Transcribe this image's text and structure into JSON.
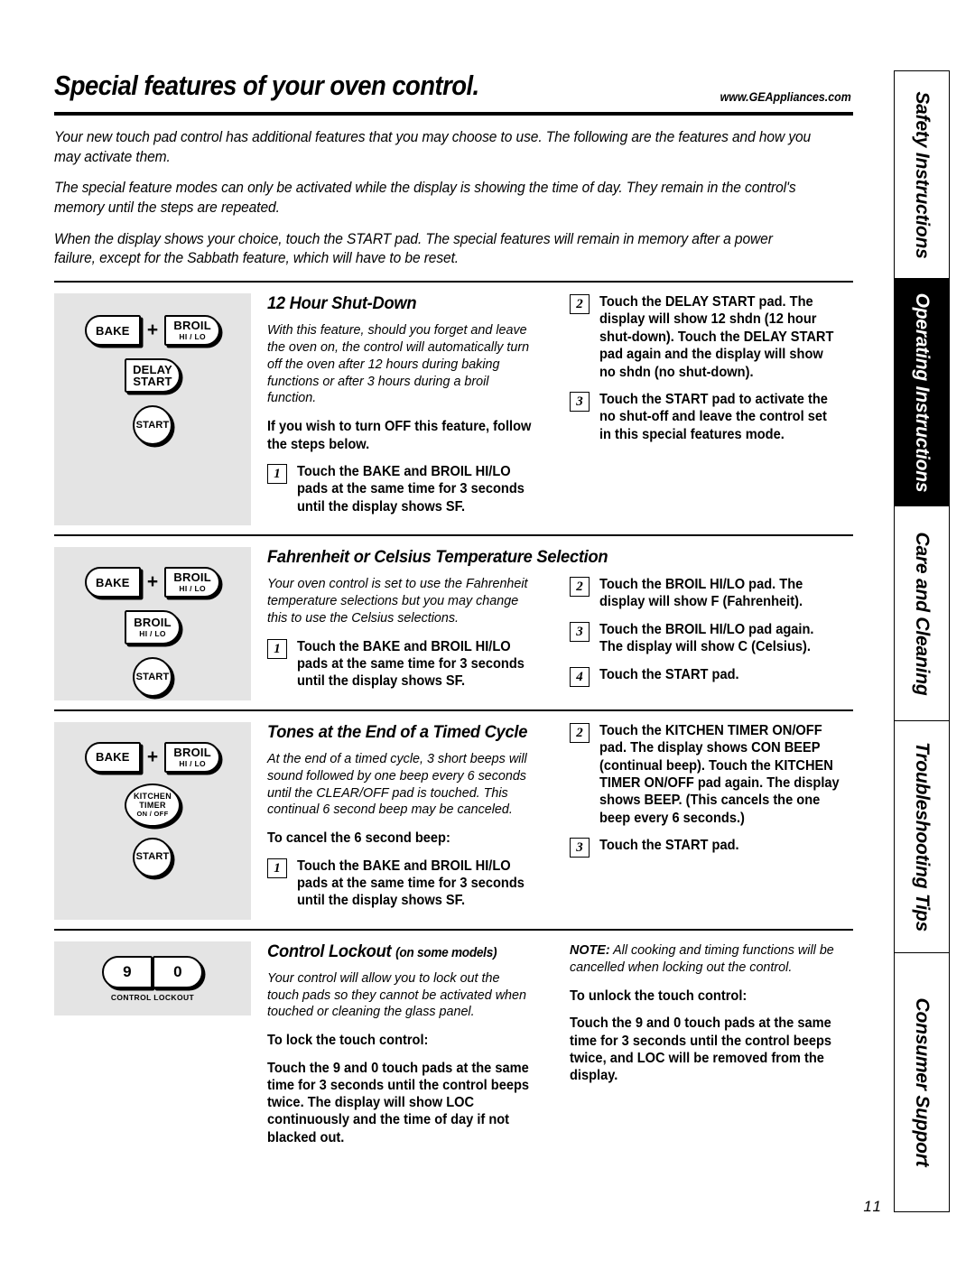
{
  "header": {
    "title": "Special features of your oven control.",
    "url": "www.GEAppliances.com"
  },
  "intro": [
    "Your new touch pad control has additional features that you may choose to use. The following are the features and how you may activate them.",
    "The special feature modes can only be activated while the display is showing the time of day. They remain in the control's memory until the steps are repeated.",
    "When the display shows your choice, touch the START pad. The special features will remain in memory after a power failure, except for the Sabbath feature, which will have to be reset."
  ],
  "pads": {
    "bake": "BAKE",
    "broil_main": "BROIL",
    "broil_sub": "HI / LO",
    "delay_l1": "DELAY",
    "delay_l2": "START",
    "start": "START",
    "kt_l1": "KITCHEN",
    "kt_l2": "TIMER",
    "kt_l3": "ON / OFF",
    "nine": "9",
    "zero": "0",
    "control_lockout_label": "CONTROL LOCKOUT",
    "plus": "+"
  },
  "sections": [
    {
      "title": "12 Hour Shut-Down",
      "subtitle": "",
      "body": "With this feature, should you forget and leave the oven on, the control will automatically turn off the oven after 12 hours during baking functions or after 3 hours during a broil function.",
      "lead": "If you wish to turn OFF this feature, follow the steps below.",
      "lead_em": "OFF",
      "steps_left": [
        {
          "num": "1",
          "text": "Touch the BAKE and BROIL HI/LO pads at the same time for 3 seconds until the display shows SF."
        }
      ],
      "steps_right": [
        {
          "num": "2",
          "text": "Touch the DELAY START pad. The display will show 12 shdn (12 hour shut-down). Touch the DELAY START pad again and the display will show no shdn (no shut-down)."
        },
        {
          "num": "3",
          "text": "Touch the START pad to activate the no shut-off and leave the control set in this special features mode."
        }
      ]
    },
    {
      "title": "Fahrenheit or Celsius Temperature Selection",
      "subtitle": "",
      "body": "Your oven control is set to use the Fahrenheit temperature selections but you may change this to use the Celsius selections.",
      "lead": "",
      "steps_left": [
        {
          "num": "1",
          "text": "Touch the BAKE and BROIL HI/LO pads at the same time for 3 seconds until the display shows SF."
        }
      ],
      "steps_right": [
        {
          "num": "2",
          "text": "Touch the BROIL HI/LO pad. The display will show F (Fahrenheit)."
        },
        {
          "num": "3",
          "text": "Touch the BROIL HI/LO pad again. The display will show C (Celsius)."
        },
        {
          "num": "4",
          "text": "Touch the START pad."
        }
      ]
    },
    {
      "title": "Tones at the End of a Timed Cycle",
      "subtitle": "",
      "body": "At the end of a timed cycle, 3 short beeps will sound followed by one beep every 6 seconds until the CLEAR/OFF pad is touched. This continual 6 second beep may be canceled.",
      "lead": "To cancel the 6 second beep:",
      "steps_left": [
        {
          "num": "1",
          "text": "Touch the BAKE and BROIL HI/LO pads at the same time for 3 seconds until the display shows SF."
        }
      ],
      "steps_right": [
        {
          "num": "2",
          "text": "Touch the KITCHEN TIMER ON/OFF pad. The display shows CON BEEP (continual beep). Touch the KITCHEN TIMER ON/OFF pad again. The display shows BEEP. (This cancels the one beep every 6 seconds.)"
        },
        {
          "num": "3",
          "text": "Touch the START pad."
        }
      ]
    },
    {
      "title": "Control Lockout",
      "subtitle": "(on some models)",
      "body": "Your control will allow you to lock out the touch pads so they cannot be activated when touched or cleaning the glass panel.",
      "lead": "To lock the touch control:",
      "lock_instruction": "Touch the 9 and 0 touch pads at the same time for 3 seconds until the control beeps twice. The display will show LOC continuously and the time of day if not blacked out.",
      "note_label": "NOTE:",
      "note": "All cooking and timing functions will be cancelled when locking out the control.",
      "unlock_lead": "To unlock the touch control:",
      "unlock_instruction": "Touch the 9 and 0 touch pads at the same time for 3 seconds until the control beeps twice, and LOC will be removed from the display."
    }
  ],
  "sidebar": {
    "tabs": [
      {
        "label": "Safety Instructions",
        "active": false
      },
      {
        "label": "Operating Instructions",
        "active": true
      },
      {
        "label": "Care and Cleaning",
        "active": false
      },
      {
        "label": "Troubleshooting Tips",
        "active": false
      },
      {
        "label": "Consumer Support",
        "active": false
      }
    ]
  },
  "page_number": "11"
}
